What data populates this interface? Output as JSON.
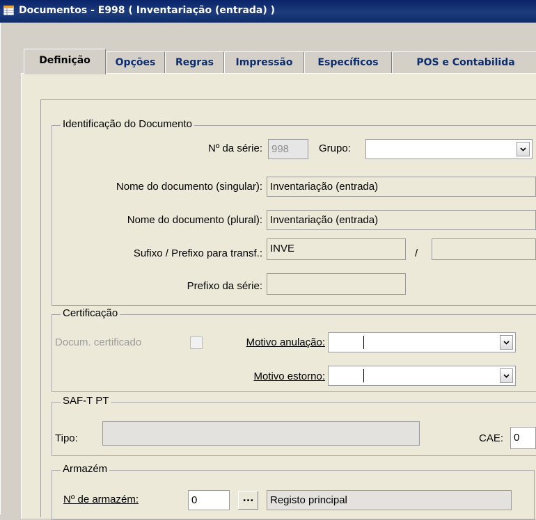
{
  "window": {
    "title": "Documentos - E998 ( Inventariação (entrada) )",
    "icon": "table-window-icon"
  },
  "tabs": [
    {
      "label": "Definição",
      "active": true
    },
    {
      "label": "Opções"
    },
    {
      "label": "Regras"
    },
    {
      "label": "Impressão"
    },
    {
      "label": "Específicos"
    },
    {
      "label": "POS e Contabilida"
    }
  ],
  "identificacao": {
    "legend": "Identificação do Documento",
    "serie_label": "Nº da série:",
    "serie_value": "998",
    "grupo_label": "Grupo:",
    "grupo_value": "",
    "nome_singular_label": "Nome do documento (singular):",
    "nome_singular_value": "Inventariação (entrada)",
    "nome_plural_label": "Nome do documento (plural):",
    "nome_plural_value": "Inventariação (entrada)",
    "sufixo_label": "Sufixo / Prefixo para transf.:",
    "sufixo_value": "INVE",
    "sufixo_sep": "/",
    "prefixo_value": "",
    "prefixo_serie_label": "Prefixo da série:",
    "prefixo_serie_value": ""
  },
  "certificacao": {
    "legend": "Certificação",
    "doc_certificado_label": "Docum. certificado",
    "motivo_anulacao_label": "Motivo anulação:",
    "motivo_anulacao_value": "",
    "motivo_estorno_label": "Motivo estorno:",
    "motivo_estorno_value": ""
  },
  "saft": {
    "legend": "SAF-T PT",
    "tipo_label": "Tipo:",
    "tipo_value": "",
    "cae_label": "CAE:",
    "cae_value": "0"
  },
  "armazem": {
    "legend": "Armazém",
    "num_label": "Nº de armazém:",
    "num_value": "0",
    "browse_label": "...",
    "desc_value": "Registo principal"
  },
  "colors": {
    "title_bg": "#0a246a",
    "tab_text": "#0b2d6d",
    "panel_bg": "#ece9d8"
  }
}
